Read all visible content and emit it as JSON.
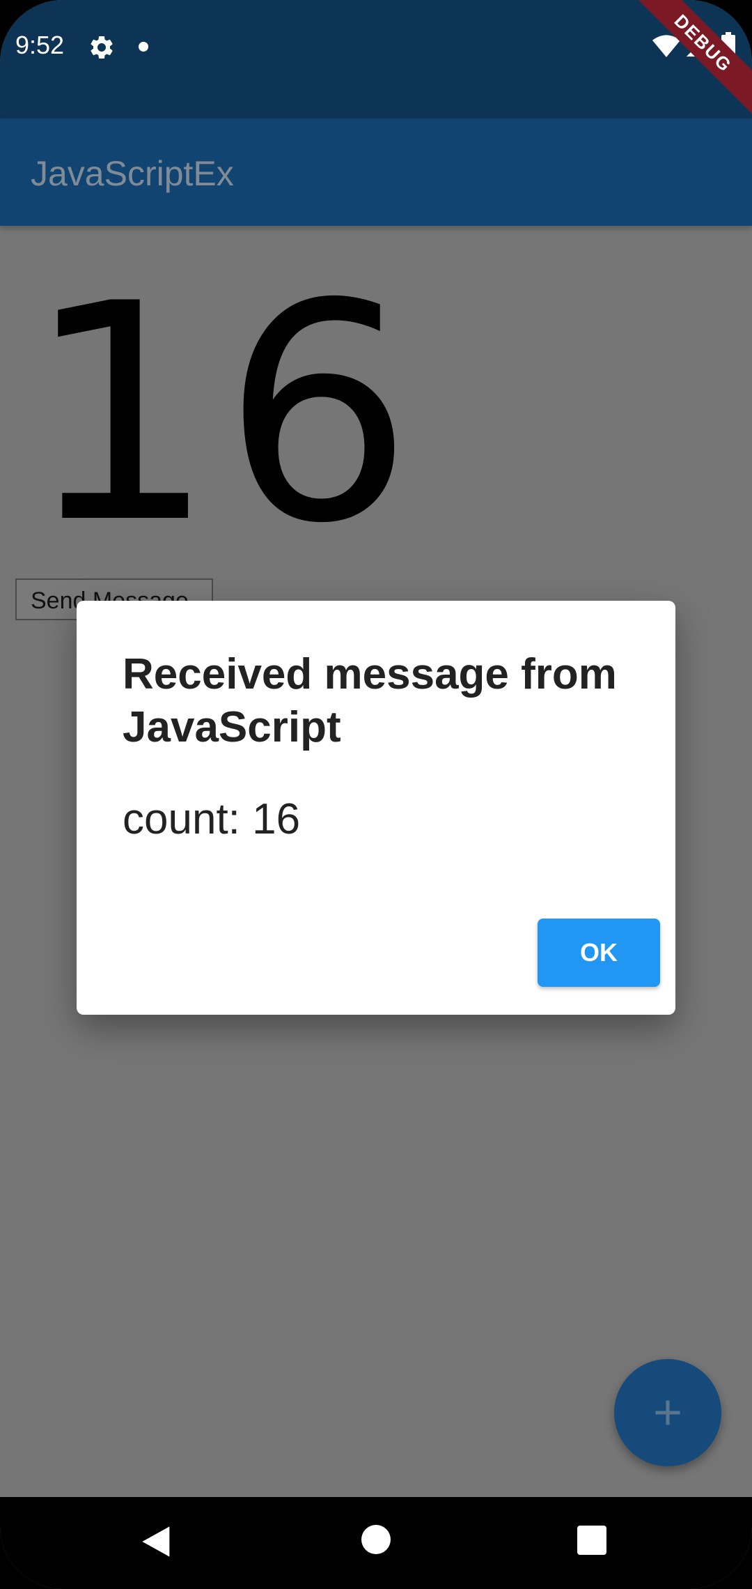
{
  "status_bar": {
    "time": "9:52",
    "icons": [
      "gear-icon",
      "dot-icon",
      "wifi-icon",
      "signal-icon",
      "battery-icon"
    ]
  },
  "debug_banner": "DEBUG",
  "app_bar": {
    "title": "JavaScriptEx"
  },
  "body": {
    "counter": "16",
    "send_button_label": "Send Message"
  },
  "dialog": {
    "title": "Received message from JavaScript",
    "content": "count: 16",
    "ok_label": "OK"
  },
  "fab": {
    "icon": "plus-icon"
  },
  "nav_bar": {
    "icons": [
      "back-icon",
      "home-icon",
      "recents-icon"
    ]
  },
  "colors": {
    "status_bar": "#0e3455",
    "app_bar": "#114470",
    "scrim_background": "#767676",
    "dialog_button": "#2196f3",
    "fab": "#154a7a",
    "debug_banner": "#7b1a24"
  }
}
